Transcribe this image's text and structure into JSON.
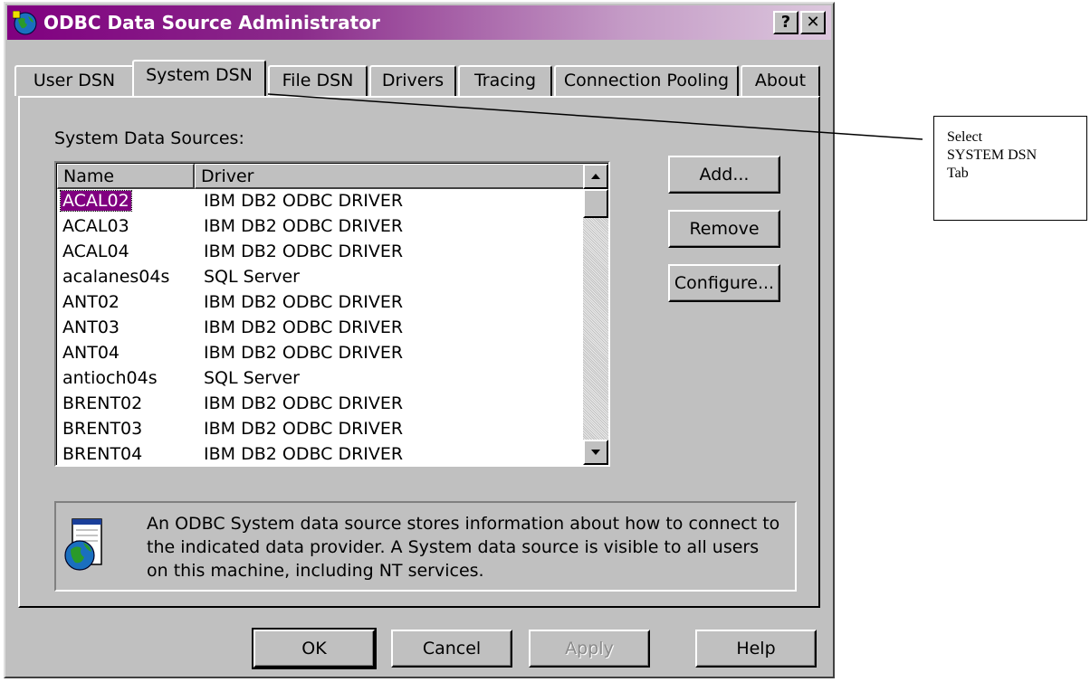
{
  "window": {
    "title": "ODBC Data Source Administrator",
    "help_glyph": "?",
    "close_glyph": "✕"
  },
  "tabs": [
    {
      "label": "User DSN"
    },
    {
      "label": "System DSN",
      "active": true
    },
    {
      "label": "File DSN"
    },
    {
      "label": "Drivers"
    },
    {
      "label": "Tracing"
    },
    {
      "label": "Connection Pooling"
    },
    {
      "label": "About"
    }
  ],
  "panel": {
    "section_label": "System Data Sources:",
    "columns": [
      "Name",
      "Driver"
    ],
    "rows": [
      {
        "name": "ACAL02",
        "driver": "IBM DB2 ODBC DRIVER",
        "selected": true
      },
      {
        "name": "ACAL03",
        "driver": "IBM DB2 ODBC DRIVER"
      },
      {
        "name": "ACAL04",
        "driver": "IBM DB2 ODBC DRIVER"
      },
      {
        "name": "acalanes04s",
        "driver": "SQL Server"
      },
      {
        "name": "ANT02",
        "driver": "IBM DB2 ODBC DRIVER"
      },
      {
        "name": "ANT03",
        "driver": "IBM DB2 ODBC DRIVER"
      },
      {
        "name": "ANT04",
        "driver": "IBM DB2 ODBC DRIVER"
      },
      {
        "name": "antioch04s",
        "driver": "SQL Server"
      },
      {
        "name": "BRENT02",
        "driver": "IBM DB2 ODBC DRIVER"
      },
      {
        "name": "BRENT03",
        "driver": "IBM DB2 ODBC DRIVER"
      },
      {
        "name": "BRENT04",
        "driver": "IBM DB2 ODBC DRIVER"
      }
    ],
    "buttons": {
      "add": "Add...",
      "remove": "Remove",
      "configure": "Configure..."
    },
    "info_text": "An ODBC System data source stores information about how to connect to the indicated data provider.   A System data source is visible to all users on this machine, including NT services."
  },
  "footer": {
    "ok": "OK",
    "cancel": "Cancel",
    "apply": "Apply",
    "help": "Help"
  },
  "callout": {
    "line1": "Select",
    "line2": "SYSTEM DSN",
    "line3": "Tab"
  },
  "colors": {
    "title_gradient_start": "#800080",
    "selection": "#800080",
    "face": "#c0c0c0"
  },
  "icons": {
    "app": "odbc-globe-icon",
    "info": "datasource-globe-icon",
    "scroll_up": "arrow-up-icon",
    "scroll_down": "arrow-down-icon"
  }
}
